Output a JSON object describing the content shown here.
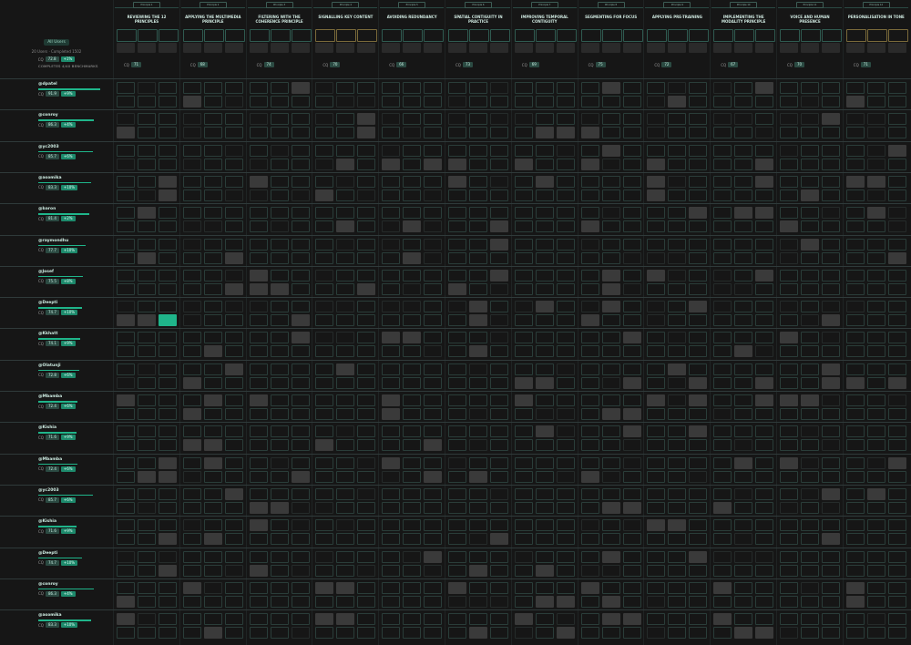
{
  "summary": {
    "view_label": "All Users",
    "stats_text": "20 Users · Completed 1502",
    "cq_label": "CQ",
    "cq_score": "72.8",
    "cq_pct": "+1%"
  },
  "completes_label": "COMPLETES 4/40 BENCHMARKS",
  "columns": [
    {
      "tag": "Principle 1",
      "title": "REVIEWING THE 12 PRINCIPLES",
      "cq": "71"
    },
    {
      "tag": "Principle 2",
      "title": "APPLYING THE MULTIMEDIA PRINCIPLE",
      "cq": "68"
    },
    {
      "tag": "Principle 3",
      "title": "FILTERING WITH THE COHERENCE PRINCIPLE",
      "cq": "74"
    },
    {
      "tag": "Principle 4",
      "title": "SIGNALLING KEY CONTENT",
      "cq": "70"
    },
    {
      "tag": "Principle 5",
      "title": "AVOIDING REDUNDANCY",
      "cq": "66"
    },
    {
      "tag": "Principle 6",
      "title": "SPATIAL CONTIGUITY IN PRACTICE",
      "cq": "73"
    },
    {
      "tag": "Principle 7",
      "title": "IMPROVING TEMPORAL CONTIGUITY",
      "cq": "69"
    },
    {
      "tag": "Principle 8",
      "title": "SEGMENTING FOR FOCUS",
      "cq": "75"
    },
    {
      "tag": "Principle 9",
      "title": "APPLYING PRE-TRAINING",
      "cq": "72"
    },
    {
      "tag": "Principle 10",
      "title": "IMPLEMENTING THE MODALITY PRINCIPLE",
      "cq": "67"
    },
    {
      "tag": "Principle 11",
      "title": "VOICE AND HUMAN PRESENCE",
      "cq": "70"
    },
    {
      "tag": "Principle 12",
      "title": "PERSONALISATION IN TONE",
      "cq": "71"
    }
  ],
  "users": [
    {
      "name": "@dpatel",
      "score": "91.9",
      "pct": "+9%",
      "progress": 0.95
    },
    {
      "name": "@conroy",
      "score": "86.3",
      "pct": "+4%",
      "progress": 0.85
    },
    {
      "name": "@yc2003",
      "score": "85.7",
      "pct": "+6%",
      "progress": 0.83
    },
    {
      "name": "@asomika",
      "score": "83.3",
      "pct": "+10%",
      "progress": 0.8
    },
    {
      "name": "@baron",
      "score": "81.4",
      "pct": "+2%",
      "progress": 0.78
    },
    {
      "name": "@raymondhu",
      "score": "77.7",
      "pct": "+10%",
      "progress": 0.72
    },
    {
      "name": "@Josef",
      "score": "75.5",
      "pct": "+8%",
      "progress": 0.68
    },
    {
      "name": "@Deepti",
      "score": "74.7",
      "pct": "+10%",
      "progress": 0.66
    },
    {
      "name": "@Kkhatt",
      "score": "74.1",
      "pct": "+9%",
      "progress": 0.64
    },
    {
      "name": "@Olatunji",
      "score": "72.8",
      "pct": "+6%",
      "progress": 0.62
    },
    {
      "name": "@Mbamba",
      "score": "72.4",
      "pct": "+6%",
      "progress": 0.6
    },
    {
      "name": "@Kishia",
      "score": "71.6",
      "pct": "+9%",
      "progress": 0.58
    },
    {
      "name": "@Mbamba",
      "score": "72.4",
      "pct": "+6%",
      "progress": 0.6
    },
    {
      "name": "@yc2003",
      "score": "85.7",
      "pct": "+6%",
      "progress": 0.83
    },
    {
      "name": "@Kishia",
      "score": "71.6",
      "pct": "+9%",
      "progress": 0.58
    },
    {
      "name": "@Deepti",
      "score": "74.7",
      "pct": "+10%",
      "progress": 0.66
    },
    {
      "name": "@conroy",
      "score": "86.3",
      "pct": "+4%",
      "progress": 0.85
    },
    {
      "name": "@asomika",
      "score": "83.3",
      "pct": "+10%",
      "progress": 0.8
    }
  ],
  "colors": {
    "background": "#161616",
    "accent": "#1fb58a",
    "cell_fill": "#3a3a3a",
    "cell_border": "#2a3d39",
    "gold_border": "#7a6a3a"
  }
}
